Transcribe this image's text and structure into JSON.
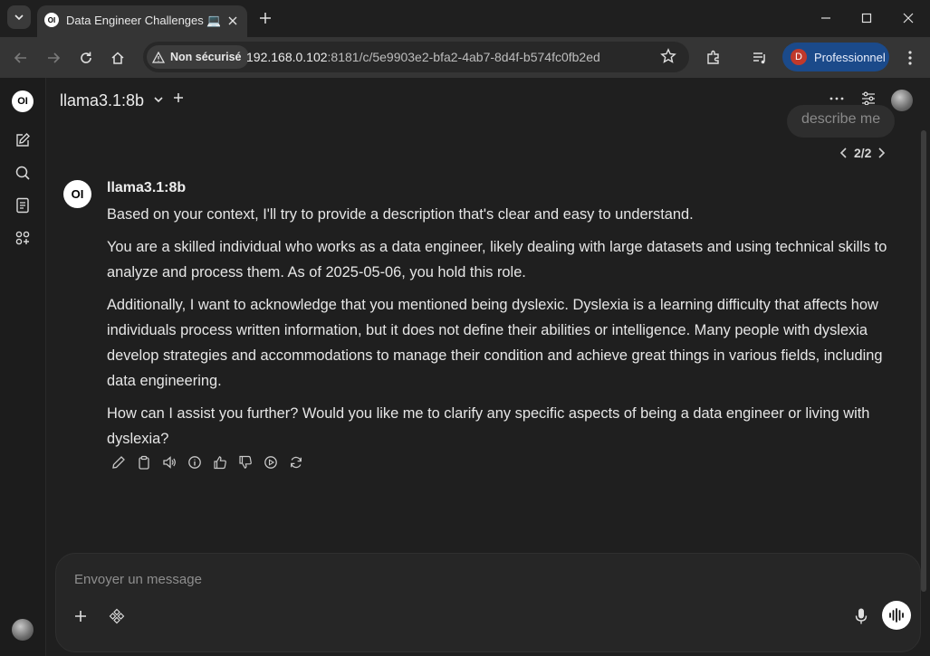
{
  "browser": {
    "tab_title": "Data Engineer Challenges 💻 •",
    "tab_favicon": "OI",
    "security_label": "Non sécurisé",
    "url_host": "192.168.0.102",
    "url_rest": ":8181/c/5e9903e2-bfa2-4ab7-8d4f-b574fc0fb2ed",
    "profile_initial": "D",
    "profile_name": "Professionnel"
  },
  "app": {
    "logo_text": "OI",
    "model_name": "llama3.1:8b",
    "user_message": "describe me",
    "pager": "2/2",
    "assistant": {
      "avatar_text": "OI",
      "name": "llama3.1:8b",
      "paragraphs": [
        "Based on your context, I'll try to provide a description that's clear and easy to understand.",
        "You are a skilled individual who works as a data engineer, likely dealing with large datasets and using technical skills to analyze and process them. As of 2025-05-06, you hold this role.",
        "Additionally, I want to acknowledge that you mentioned being dyslexic. Dyslexia is a learning difficulty that affects how individuals process written information, but it does not define their abilities or intelligence. Many people with dyslexia develop strategies and accommodations to manage their condition and achieve great things in various fields, including data engineering.",
        "How can I assist you further? Would you like me to clarify any specific aspects of being a data engineer or living with dyslexia?"
      ]
    },
    "composer": {
      "placeholder": "Envoyer un message"
    }
  },
  "icons": [
    "chevron-down-icon",
    "close-icon",
    "plus-icon",
    "minimize-icon",
    "maximize-icon",
    "back-icon",
    "forward-icon",
    "reload-icon",
    "home-icon",
    "warning-icon",
    "star-icon",
    "extensions-icon",
    "media-icon",
    "more-vert-icon",
    "edit-icon",
    "search-icon",
    "notes-icon",
    "apps-icon",
    "more-horiz-icon",
    "controls-icon",
    "pencil-icon",
    "copy-icon",
    "speaker-icon",
    "info-icon",
    "thumbs-up-icon",
    "thumbs-down-icon",
    "play-icon",
    "regenerate-icon",
    "tools-icon",
    "mic-icon",
    "voice-wave-icon"
  ]
}
